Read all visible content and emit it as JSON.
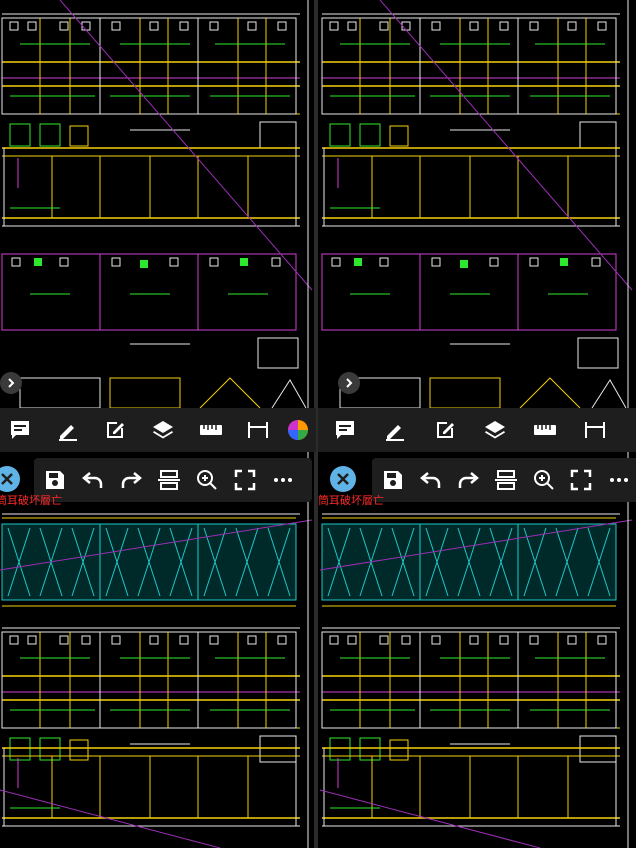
{
  "colors": {
    "background": "#000000",
    "toolbar_bg": "#1e1e1e",
    "icon": "#ffffff",
    "close_button": "#5fb3e6",
    "layer_text": "#ff2a2a",
    "cad_yellow": "#f5d10a",
    "cad_green": "#2ee82e",
    "cad_magenta": "#d040d0",
    "cad_cyan": "#1fc8c8",
    "cad_white": "#e8e8e8"
  },
  "panes": [
    {
      "layer_label": "筒耳破坏層亡",
      "markup_tools": [
        "comment-icon",
        "pen-icon",
        "edit-icon",
        "layers-icon",
        "ruler-icon",
        "dimension-icon"
      ],
      "action_tools": [
        "save-icon",
        "undo-icon",
        "redo-icon",
        "trim-icon",
        "zoom-icon",
        "fullscreen-icon",
        "more-icon"
      ]
    },
    {
      "layer_label": "筒耳破坏層亡",
      "markup_tools": [
        "comment-icon",
        "pen-icon",
        "edit-icon",
        "layers-icon",
        "ruler-icon",
        "dimension-icon"
      ],
      "action_tools": [
        "save-icon",
        "undo-icon",
        "redo-icon",
        "trim-icon",
        "zoom-icon",
        "fullscreen-icon",
        "more-icon"
      ]
    }
  ]
}
